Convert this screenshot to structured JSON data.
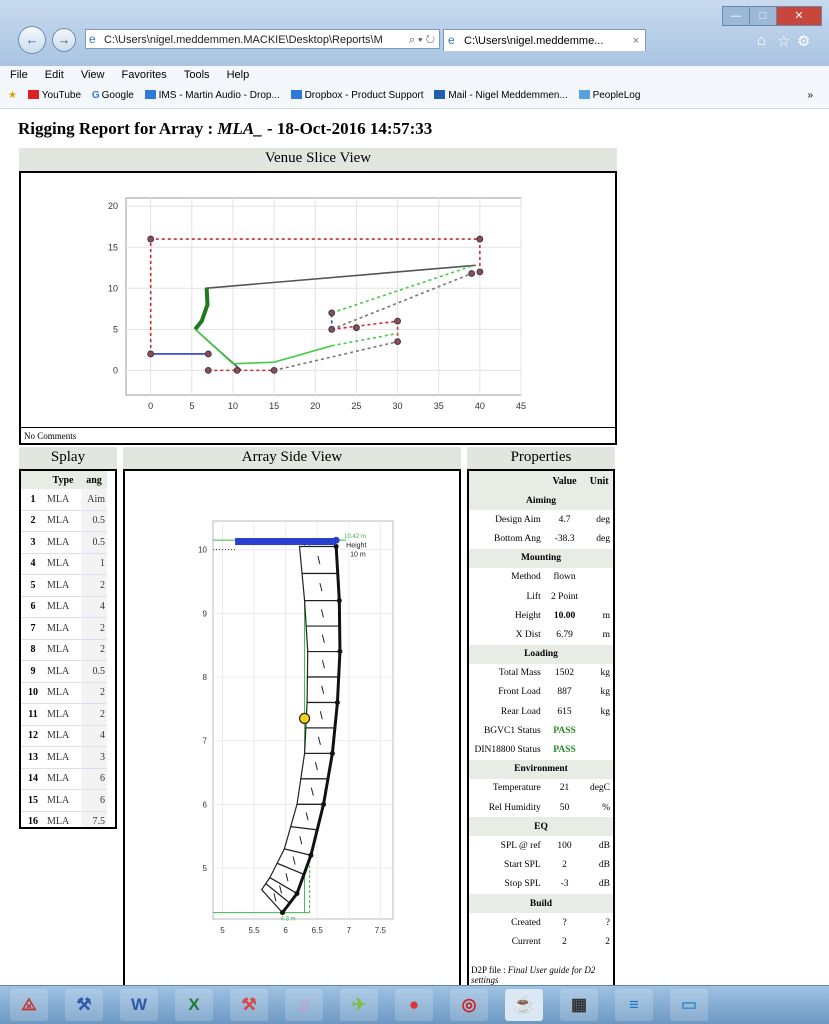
{
  "browser": {
    "address": "C:\\Users\\nigel.meddemmen.MACKIE\\Desktop\\Reports\\M",
    "address_controls": "⌕ ▾ ↻",
    "tab_title": "C:\\Users\\nigel.meddemme...",
    "tab_close": "×",
    "menu": [
      "File",
      "Edit",
      "View",
      "Favorites",
      "Tools",
      "Help"
    ],
    "favorites": [
      "YouTube",
      "Google",
      "IMS - Martin Audio - Drop...",
      "Dropbox - Product Support",
      "Mail - Nigel Meddemmen...",
      "PeopleLog"
    ],
    "favorites_more": "»",
    "window_controls": [
      "—",
      "□",
      "✕"
    ],
    "toolbar_icons": [
      "home-icon",
      "star-icon",
      "gear-icon"
    ],
    "colors": {
      "titlebar": "#b7cfe9",
      "close": "#c9463d",
      "section": "#e1e7df"
    }
  },
  "report": {
    "title_prefix": "Rigging Report for Array : ",
    "array_name": "MLA_",
    "title_suffix": " - 18-Oct-2016 14:57:33"
  },
  "venue": {
    "heading": "Venue Slice View",
    "comments": "No Comments"
  },
  "splay": {
    "heading": "Splay",
    "columns": [
      "",
      "Type",
      "ang"
    ],
    "rows": [
      [
        "1",
        "MLA",
        "Aim"
      ],
      [
        "2",
        "MLA",
        "0.5"
      ],
      [
        "3",
        "MLA",
        "0.5"
      ],
      [
        "4",
        "MLA",
        "1"
      ],
      [
        "5",
        "MLA",
        "2"
      ],
      [
        "6",
        "MLA",
        "4"
      ],
      [
        "7",
        "MLA",
        "2"
      ],
      [
        "8",
        "MLA",
        "2"
      ],
      [
        "9",
        "MLA",
        "0.5"
      ],
      [
        "10",
        "MLA",
        "2"
      ],
      [
        "11",
        "MLA",
        "2"
      ],
      [
        "12",
        "MLA",
        "4"
      ],
      [
        "13",
        "MLA",
        "3"
      ],
      [
        "14",
        "MLA",
        "6"
      ],
      [
        "15",
        "MLA",
        "6"
      ],
      [
        "16",
        "MLA",
        "7.5"
      ]
    ]
  },
  "side": {
    "heading": "Array Side View",
    "height_label": "Height",
    "height_value": "10 m",
    "top_dim": "10.42 m",
    "bottom_dim": "4.3 m"
  },
  "properties": {
    "heading": "Properties",
    "columns": [
      "",
      "Value",
      "Unit"
    ],
    "rows": [
      {
        "section": "Aiming"
      },
      {
        "k": "Design Aim",
        "v": "4.7",
        "u": "deg"
      },
      {
        "k": "Bottom Ang",
        "v": "-38.3",
        "u": "deg"
      },
      {
        "section": "Mounting"
      },
      {
        "k": "Method",
        "v": "flown",
        "u": ""
      },
      {
        "k": "Lift",
        "v": "2 Point",
        "u": ""
      },
      {
        "k": "Height",
        "v": "10.00",
        "u": "m",
        "bold": true
      },
      {
        "k": "X Dist",
        "v": "6.79",
        "u": "m"
      },
      {
        "section": "Loading"
      },
      {
        "k": "Total Mass",
        "v": "1502",
        "u": "kg"
      },
      {
        "k": "Front Load",
        "v": "887",
        "u": "kg"
      },
      {
        "k": "Rear Load",
        "v": "615",
        "u": "kg"
      },
      {
        "k": "BGVC1 Status",
        "v": "PASS",
        "u": "",
        "pass": true,
        "bold": true
      },
      {
        "k": "DIN18800 Status",
        "v": "PASS",
        "u": "",
        "pass": true,
        "bold": true
      },
      {
        "section": "Environment"
      },
      {
        "k": "Temperature",
        "v": "21",
        "u": "degC"
      },
      {
        "k": "Rel Humidity",
        "v": "50",
        "u": "%"
      },
      {
        "section": "EQ"
      },
      {
        "k": "SPL @ ref",
        "v": "100",
        "u": "dB"
      },
      {
        "k": "Start SPL",
        "v": "2",
        "u": "dB"
      },
      {
        "k": "Stop SPL",
        "v": "-3",
        "u": "dB"
      },
      {
        "section": "Build"
      },
      {
        "k": "Created",
        "v": "?",
        "u": "?"
      },
      {
        "k": "Current",
        "v": "2",
        "u": "2"
      }
    ],
    "footnote_prefix": "D2P file : ",
    "footnote_value": "Final User guide for D2 settings"
  },
  "chart_data": [
    {
      "type": "line",
      "xlim": [
        -3,
        45
      ],
      "ylim": [
        -3,
        21
      ],
      "xticks": [
        0,
        5,
        10,
        15,
        20,
        25,
        30,
        35,
        40,
        45
      ],
      "yticks": [
        0,
        5,
        10,
        15,
        20
      ],
      "grid": true,
      "series": [
        {
          "color": "#cc2b2b",
          "dash": true,
          "points": [
            [
              0,
              2
            ],
            [
              0,
              16
            ],
            [
              40,
              16
            ],
            [
              40,
              12
            ]
          ]
        },
        {
          "color": "#cc2b2b",
          "dash": true,
          "points": [
            [
              7,
              0
            ],
            [
              10.5,
              0
            ],
            [
              15,
              0
            ]
          ]
        },
        {
          "color": "#cc2b2b",
          "dash": true,
          "points": [
            [
              22,
              5
            ],
            [
              30,
              6
            ],
            [
              30,
              3.5
            ]
          ]
        },
        {
          "color": "#2a3fcf",
          "dash": false,
          "points": [
            [
              0,
              2
            ],
            [
              7,
              2
            ]
          ]
        },
        {
          "color": "#2a3fcf",
          "dash": true,
          "points": [
            [
              22,
              5
            ],
            [
              22,
              7
            ]
          ]
        },
        {
          "color": "#555555",
          "dash": false,
          "points": [
            [
              6.6,
              10
            ],
            [
              39.5,
              12.8
            ]
          ]
        },
        {
          "color": "#555555",
          "dash": false,
          "points": [
            [
              5.4,
              5
            ],
            [
              11,
              0
            ]
          ]
        },
        {
          "color": "#777777",
          "dash": true,
          "points": [
            [
              15,
              0
            ],
            [
              30,
              3.5
            ]
          ]
        },
        {
          "color": "#777777",
          "dash": true,
          "points": [
            [
              22,
              5
            ],
            [
              39,
              11.8
            ]
          ]
        },
        {
          "color": "#1f7a1f",
          "dash": false,
          "width": 4,
          "points": [
            [
              6.8,
              10
            ],
            [
              6.9,
              8
            ],
            [
              6.2,
              6
            ],
            [
              5.4,
              5
            ]
          ]
        },
        {
          "color": "#44cc44",
          "dash": false,
          "points": [
            [
              5.4,
              5
            ],
            [
              10,
              0.8
            ],
            [
              15,
              1
            ],
            [
              22,
              3
            ]
          ]
        },
        {
          "color": "#44cc44",
          "dash": true,
          "points": [
            [
              22,
              3
            ],
            [
              30,
              4.5
            ]
          ]
        },
        {
          "color": "#44cc44",
          "dash": true,
          "points": [
            [
              22,
              7
            ],
            [
              39,
              12.7
            ]
          ]
        }
      ],
      "markers": [
        [
          0,
          16
        ],
        [
          40,
          16
        ],
        [
          40,
          12
        ],
        [
          39,
          11.8
        ],
        [
          0,
          2
        ],
        [
          7,
          2
        ],
        [
          7,
          0
        ],
        [
          10.5,
          0
        ],
        [
          15,
          0
        ],
        [
          22,
          7
        ],
        [
          22,
          5
        ],
        [
          25,
          5.2
        ],
        [
          30,
          6
        ],
        [
          30,
          3.5
        ]
      ]
    },
    {
      "type": "line",
      "xlim": [
        4.85,
        7.7
      ],
      "ylim": [
        4.2,
        10.45
      ],
      "xticks": [
        5,
        5.5,
        6,
        6.5,
        7,
        7.5
      ],
      "yticks": [
        5,
        6,
        7,
        8,
        9,
        10
      ],
      "grid": true,
      "bar_left": [
        5.2,
        10.12
      ],
      "bar_right": [
        6.8,
        10.1
      ],
      "pivot": [
        6.3,
        7.35
      ],
      "cabinets": 16,
      "front_curve": [
        [
          6.22,
          10.05
        ],
        [
          6.3,
          9.2
        ],
        [
          6.35,
          8.4
        ],
        [
          6.34,
          7.6
        ],
        [
          6.3,
          6.8
        ],
        [
          6.18,
          6.0
        ],
        [
          5.98,
          5.3
        ],
        [
          5.75,
          4.85
        ],
        [
          5.62,
          4.66
        ]
      ],
      "rear_curve": [
        [
          6.8,
          10.05
        ],
        [
          6.85,
          9.2
        ],
        [
          6.86,
          8.4
        ],
        [
          6.82,
          7.6
        ],
        [
          6.74,
          6.8
        ],
        [
          6.6,
          6.0
        ],
        [
          6.4,
          5.2
        ],
        [
          6.18,
          4.6
        ],
        [
          5.95,
          4.3
        ]
      ],
      "guide_x": [
        6.3,
        6.38
      ],
      "guide_y": [
        10.15,
        4.3
      ]
    }
  ],
  "taskbar": {
    "apps": [
      "acrobat-icon",
      "settings-icon",
      "word-icon",
      "excel-icon",
      "toolbox-icon",
      "itunes-icon",
      "martin-icon",
      "chrome-icon",
      "antivirus-icon",
      "java-icon",
      "layout-icon",
      "display-icon",
      "window-icon"
    ]
  }
}
